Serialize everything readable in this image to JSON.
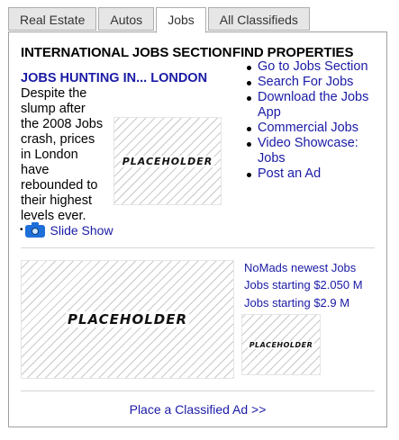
{
  "tabs": [
    {
      "label": "Real Estate",
      "active": false
    },
    {
      "label": "Autos",
      "active": false
    },
    {
      "label": "Jobs",
      "active": true
    },
    {
      "label": "All Classifieds",
      "active": false
    }
  ],
  "jobs_section": {
    "title": "INTERNATIONAL JOBS SECTION",
    "headline": "JOBS HUNTING IN... LONDON",
    "body_lines": [
      "Despite the",
      "slump after",
      "the 2008 Jobs",
      "crash, prices",
      "in London",
      "have",
      "rebounded to",
      "their highest",
      "levels ever."
    ],
    "image_label": "PLACEHOLDER",
    "slideshow_label": "Slide Show"
  },
  "find_properties": {
    "title": "FIND PROPERTIES",
    "links": [
      {
        "label_lines": [
          "Go to Jobs Section"
        ]
      },
      {
        "label_lines": [
          "Search For Jobs"
        ]
      },
      {
        "label_lines": [
          "Download the Jobs",
          "App"
        ]
      },
      {
        "label_lines": [
          "Commercial Jobs"
        ]
      },
      {
        "label_lines": [
          "Video Showcase:",
          "Jobs"
        ]
      },
      {
        "label_lines": [
          "Post an Ad"
        ]
      }
    ]
  },
  "bottom": {
    "large_image_label": "PLACEHOLDER",
    "small_image_label": "PLACEHOLDER",
    "links": [
      "NoMads newest Jobs",
      "Jobs starting $2.050 M",
      "Jobs starting $2.9 M"
    ]
  },
  "place_ad_label": "Place a Classified Ad >>",
  "colors": {
    "link": "#1a1aa6",
    "border": "#9f9f9f",
    "tab_bg": "#e6e6e6",
    "camera": "#1e6fd9"
  },
  "icons": {
    "slideshow": "camera-icon"
  }
}
